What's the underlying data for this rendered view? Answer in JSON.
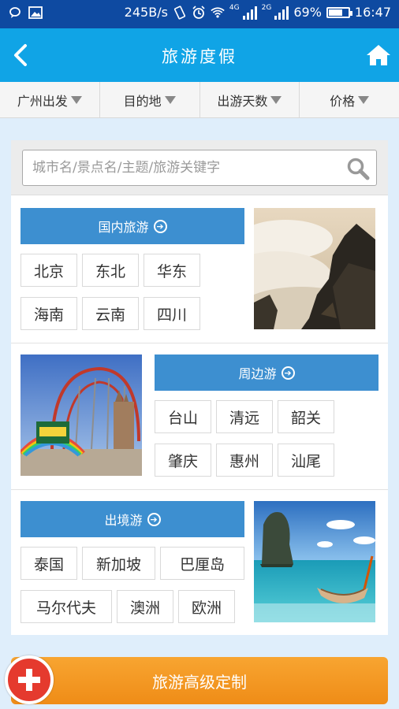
{
  "status_bar": {
    "net_speed": "245B/s",
    "network_4g": "4G",
    "network_2g": "2G",
    "battery_percent": "69%",
    "battery_level": 0.69,
    "time": "16:47"
  },
  "header": {
    "title": "旅游度假",
    "back_icon": "chevron-left-icon",
    "home_icon": "home-icon"
  },
  "filters": [
    {
      "label": "广州出发"
    },
    {
      "label": "目的地"
    },
    {
      "label": "出游天数"
    },
    {
      "label": "价格"
    }
  ],
  "search": {
    "placeholder": "城市名/景点名/主题/旅游关键字"
  },
  "sections": {
    "domestic": {
      "title": "国内旅游",
      "items": [
        "北京",
        "东北",
        "华东",
        "海南",
        "云南",
        "四川"
      ]
    },
    "nearby": {
      "title": "周边游",
      "items": [
        "台山",
        "清远",
        "韶关",
        "肇庆",
        "惠州",
        "汕尾"
      ]
    },
    "outbound": {
      "title": "出境游",
      "items": [
        "泰国",
        "新加坡",
        "巴厘岛",
        "马尔代夫",
        "澳洲",
        "欧洲"
      ]
    }
  },
  "cta": {
    "label": "旅游高级定制"
  },
  "colors": {
    "status_bar": "#0e4aa1",
    "title_bar": "#10a4e6",
    "section_header": "#3d8fd0",
    "cta": "#f39a22",
    "plus_button": "#e53a2e"
  }
}
